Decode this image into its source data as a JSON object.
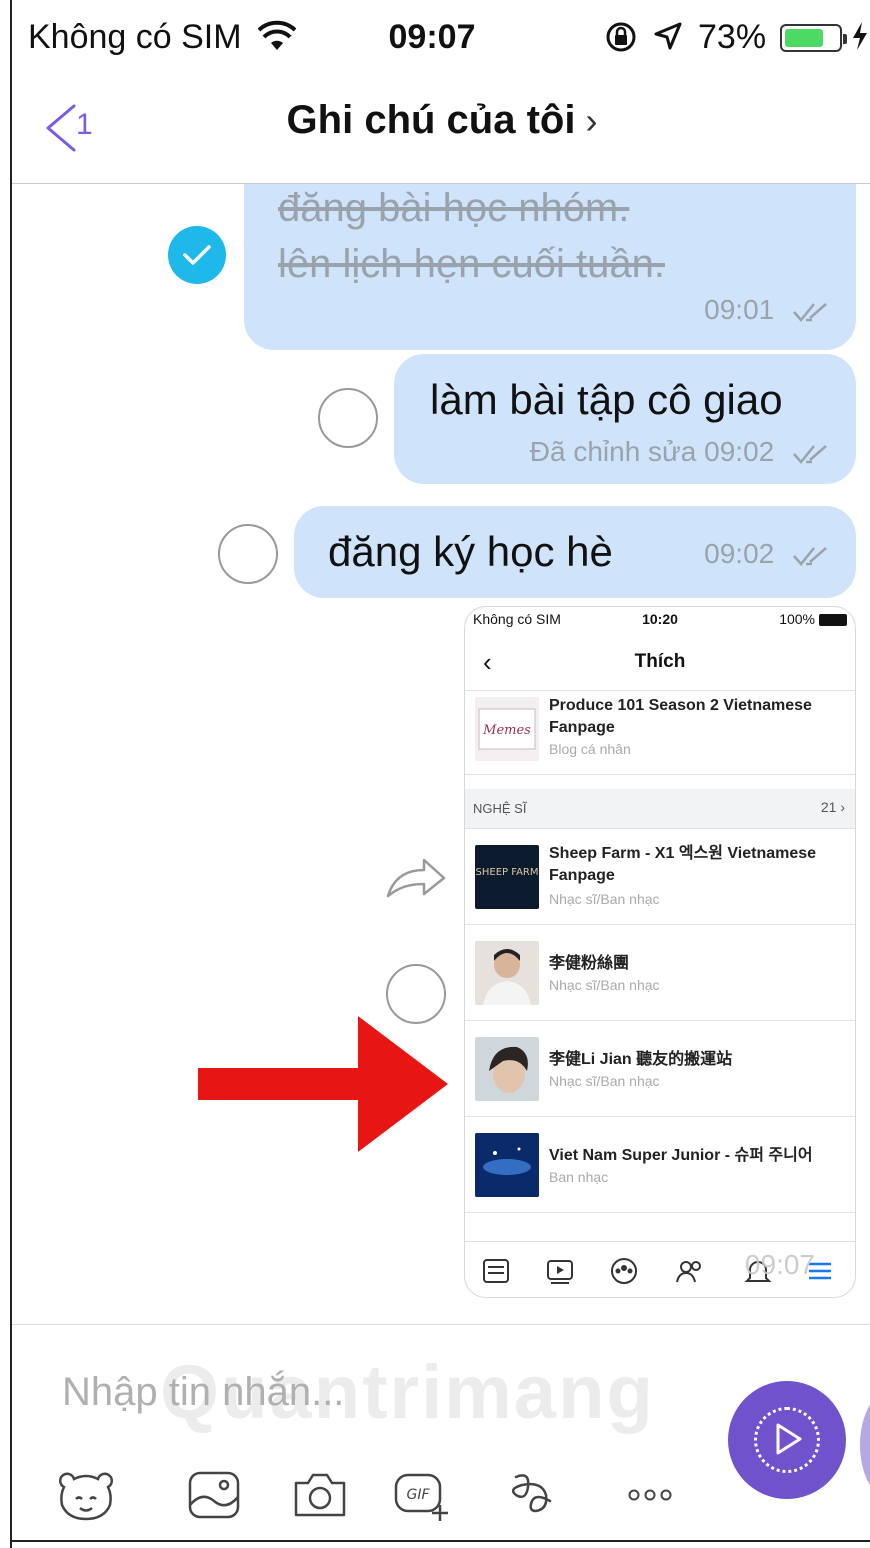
{
  "status_bar": {
    "carrier": "Không có SIM",
    "time": "09:07",
    "battery_percent": "73%",
    "battery_level": 0.73
  },
  "nav": {
    "back_count": "1",
    "title": "Ghi chú của tôi",
    "title_chevron": "›"
  },
  "messages": [
    {
      "lines": [
        "đăng bài học nhóm.",
        "lên lịch hẹn cuối tuần."
      ],
      "time": "09:01",
      "done": true
    },
    {
      "text": "làm bài tập cô giao",
      "edited_label": "Đã chỉnh sửa",
      "time": "09:02",
      "done": false
    },
    {
      "text": "đăng ký học hè",
      "time": "09:02",
      "done": false
    }
  ],
  "shared_screenshot": {
    "status": {
      "carrier": "Không có SIM",
      "time": "10:20",
      "battery": "100%"
    },
    "back": "‹",
    "title": "Thích",
    "section_label": "NGHỆ SĨ",
    "section_count": "21",
    "section_chevron": "›",
    "overlay_time": "09:07",
    "rows": [
      {
        "name": "Produce 101 Season 2 Vietnamese Fanpage",
        "sub": "Blog cá nhân",
        "thumb_text": "Memes"
      },
      {
        "name": "Sheep Farm - X1 엑스원 Vietnamese Fanpage",
        "sub": "Nhạc sĩ/Ban nhạc",
        "thumb_text": "SHEEP FARM"
      },
      {
        "name": "李健粉絲團",
        "sub": "Nhạc sĩ/Ban nhạc"
      },
      {
        "name": "李健Li Jian 聽友的搬運站",
        "sub": "Nhạc sĩ/Ban nhạc"
      },
      {
        "name": "Viet Nam Super Junior - 슈퍼 주니어",
        "sub": "Ban nhạc"
      }
    ]
  },
  "composer": {
    "placeholder": "Nhập tin nhắn...",
    "watermark": "Quantrimang",
    "tools": [
      "sticker-icon",
      "gallery-icon",
      "camera-icon",
      "gif-icon",
      "doodle-icon",
      "more-icon"
    ]
  },
  "colors": {
    "accent": "#7a5ce0",
    "bubble": "#cfe4fb",
    "check": "#1eb8ea",
    "record": "#6f52cc",
    "annotation_arrow": "#e81515"
  }
}
